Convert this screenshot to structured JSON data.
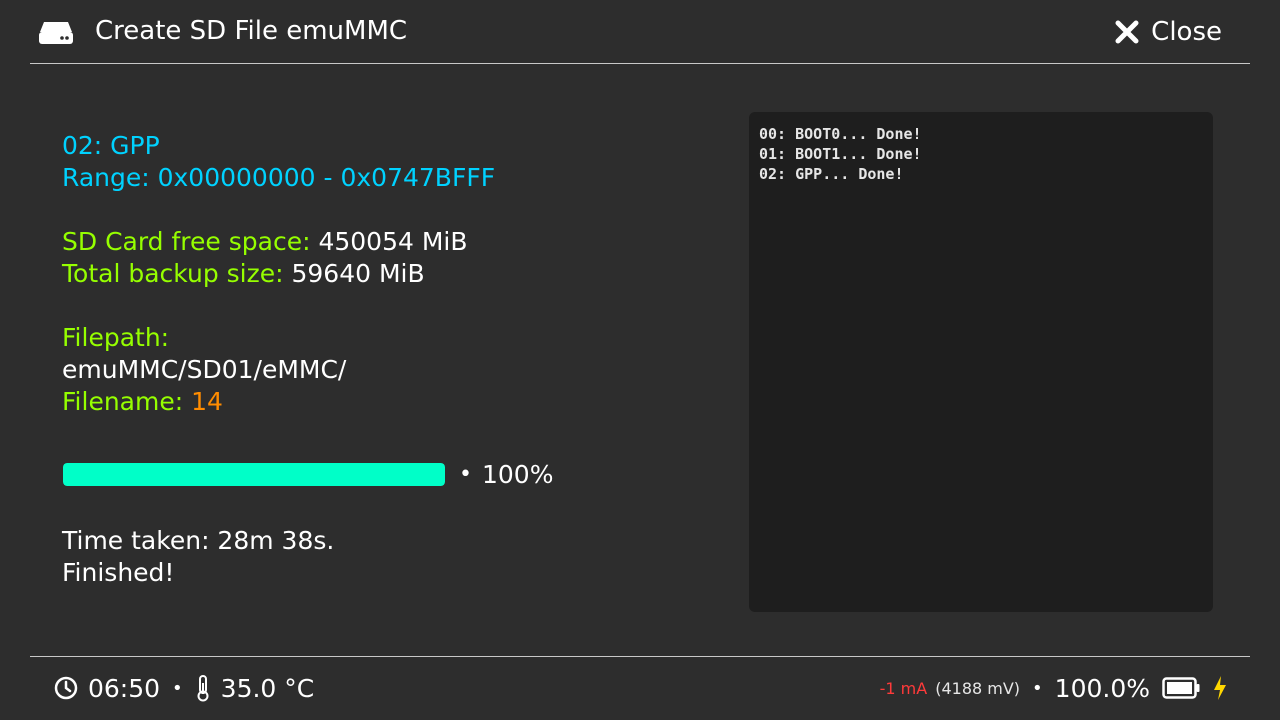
{
  "header": {
    "title": "Create SD File emuMMC",
    "close_label": "Close",
    "icon": "drive-icon"
  },
  "info": {
    "partition": "02: GPP",
    "range": "Range: 0x00000000 - 0x0747BFFF",
    "free_space_label": "SD Card free space:",
    "free_space_value": "450054 MiB",
    "backup_size_label": "Total backup size:",
    "backup_size_value": "59640 MiB",
    "filepath_label": "Filepath:",
    "filepath_value": "emuMMC/SD01/eMMC/",
    "filename_label": "Filename:",
    "filename_value": "14"
  },
  "progress": {
    "percent": 100,
    "separator": "•",
    "text": "100%"
  },
  "status": {
    "time_taken": "Time taken: 28m 38s.",
    "result": "Finished!"
  },
  "log": {
    "lines": [
      "00: BOOT0... Done!",
      "01: BOOT1... Done!",
      "02: GPP... Done!"
    ]
  },
  "footer": {
    "time": "06:50",
    "separator": "•",
    "temperature": "35.0 °C",
    "current": "-1 mA",
    "voltage": "(4188 mV)",
    "battery_percent": "100.0%",
    "charging": true
  },
  "colors": {
    "background": "#2d2d2d",
    "log_background": "#1e1e1e",
    "cyan": "#00d2ff",
    "green": "#96ff00",
    "orange": "#ff8c00",
    "progress": "#00ffc8",
    "current": "#ff3a3a",
    "bolt": "#ffd700"
  }
}
